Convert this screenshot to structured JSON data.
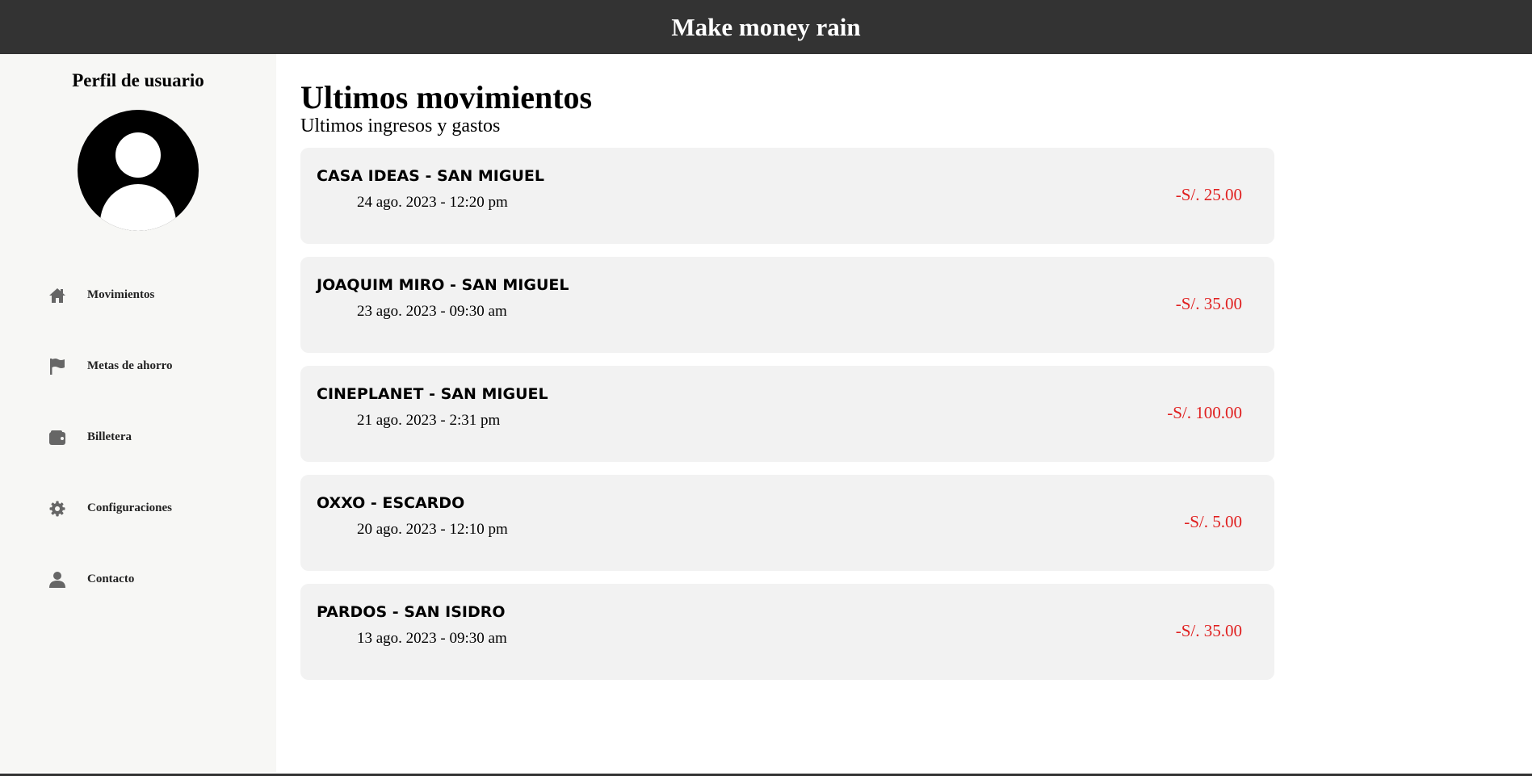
{
  "header": {
    "title": "Make money rain"
  },
  "sidebar": {
    "profile_title": "Perfil de usuario",
    "items": [
      {
        "label": "Movimientos",
        "icon": "home-icon"
      },
      {
        "label": "Metas de ahorro",
        "icon": "flag-icon"
      },
      {
        "label": "Billetera",
        "icon": "wallet-icon"
      },
      {
        "label": "Configuraciones",
        "icon": "gear-icon"
      },
      {
        "label": "Contacto",
        "icon": "user-icon"
      }
    ]
  },
  "main": {
    "title": "Ultimos movimientos",
    "subtitle": "Ultimos ingresos y gastos",
    "transactions": [
      {
        "merchant": "CASA IDEAS - SAN MIGUEL",
        "date": "24 ago. 2023 - 12:20 pm",
        "amount": "-S/. 25.00"
      },
      {
        "merchant": "JOAQUIM MIRO - SAN MIGUEL",
        "date": "23 ago. 2023 - 09:30 am",
        "amount": "-S/. 35.00"
      },
      {
        "merchant": "CINEPLANET - SAN MIGUEL",
        "date": "21 ago. 2023 - 2:31 pm",
        "amount": "-S/. 100.00"
      },
      {
        "merchant": "OXXO - ESCARDO",
        "date": "20 ago. 2023 - 12:10 pm",
        "amount": "-S/. 5.00"
      },
      {
        "merchant": "PARDOS - SAN ISIDRO",
        "date": "13 ago. 2023 - 09:30 am",
        "amount": "-S/. 35.00"
      }
    ]
  },
  "colors": {
    "header_bg": "#333333",
    "sidebar_bg": "#f7f7f5",
    "card_bg": "#f2f2f2",
    "amount_negative": "#e02020",
    "icon": "#666666"
  }
}
